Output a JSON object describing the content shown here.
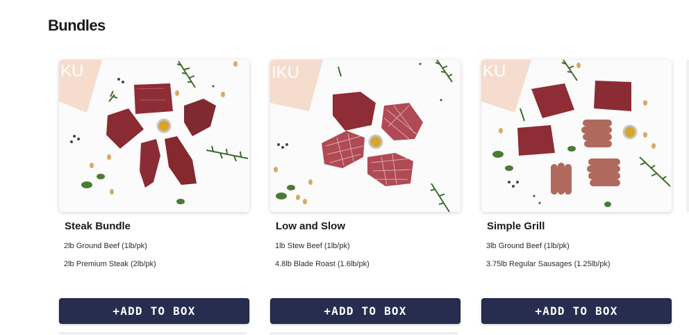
{
  "section": {
    "title": "Bundles"
  },
  "colors": {
    "button": "#262d4f",
    "button_text": "#ffffff",
    "box_peach": "#f6dccd",
    "meat": "#8e2d35"
  },
  "products": [
    {
      "title": "Steak Bundle",
      "items": [
        "2lb Ground Beef (1lb/pk)",
        "2lb Premium Steak (2lb/pk)"
      ],
      "box_text": "KU",
      "button_label": "+ADD TO BOX"
    },
    {
      "title": "Low and Slow",
      "items": [
        "1lb Stew Beef (1lb/pk)",
        "4.8lb Blade Roast (1.6lb/pk)"
      ],
      "box_text": "IKU",
      "button_label": "+ADD TO BOX"
    },
    {
      "title": "Simple Grill",
      "items": [
        "3lb Ground Beef (1lb/pk)",
        "3.75lb Regular Sausages (1.25lb/pk)"
      ],
      "box_text": "KU",
      "button_label": "+ADD TO BOX"
    }
  ]
}
